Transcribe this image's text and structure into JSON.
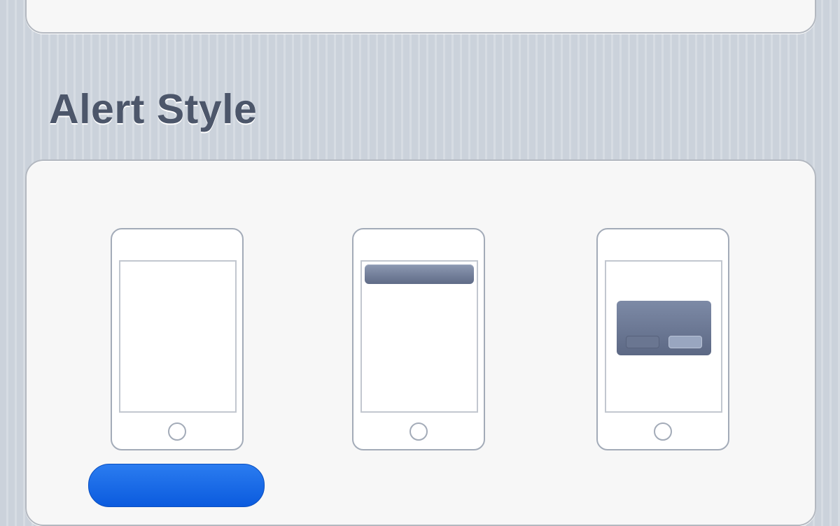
{
  "section": {
    "title": "Alert Style"
  },
  "alert_style": {
    "options": [
      {
        "id": "none",
        "icon": "phone-no-alert-icon",
        "selected": true
      },
      {
        "id": "banners",
        "icon": "phone-banner-icon",
        "selected": false
      },
      {
        "id": "alerts",
        "icon": "phone-alert-dialog-icon",
        "selected": false
      }
    ],
    "selected_index": 0
  },
  "colors": {
    "selection_blue": "#0b5bde",
    "title_text": "#4c566a",
    "card_background": "#f7f7f7",
    "banner": "#6d7994"
  }
}
